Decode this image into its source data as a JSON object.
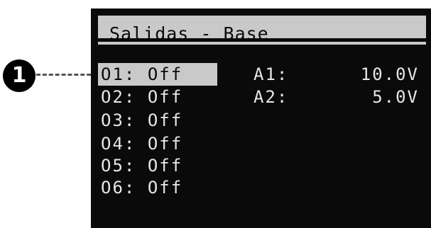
{
  "screen": {
    "title": "Salidas - Base"
  },
  "callout": {
    "number": "1"
  },
  "outputs": [
    {
      "name": "O1:",
      "state": "Off",
      "selected": true
    },
    {
      "name": "O2:",
      "state": "Off",
      "selected": false
    },
    {
      "name": "O3:",
      "state": "Off",
      "selected": false
    },
    {
      "name": "O4:",
      "state": "Off",
      "selected": false
    },
    {
      "name": "O5:",
      "state": "Off",
      "selected": false
    },
    {
      "name": "O6:",
      "state": "Off",
      "selected": false
    }
  ],
  "analog_outputs": [
    {
      "name": "A1:",
      "value": "10.0V"
    },
    {
      "name": "A2:",
      "value": "5.0V"
    }
  ],
  "colors": {
    "lcd_background": "#0a0a0a",
    "lcd_foreground": "#e6e6e6",
    "highlight": "#c9c9c9"
  }
}
